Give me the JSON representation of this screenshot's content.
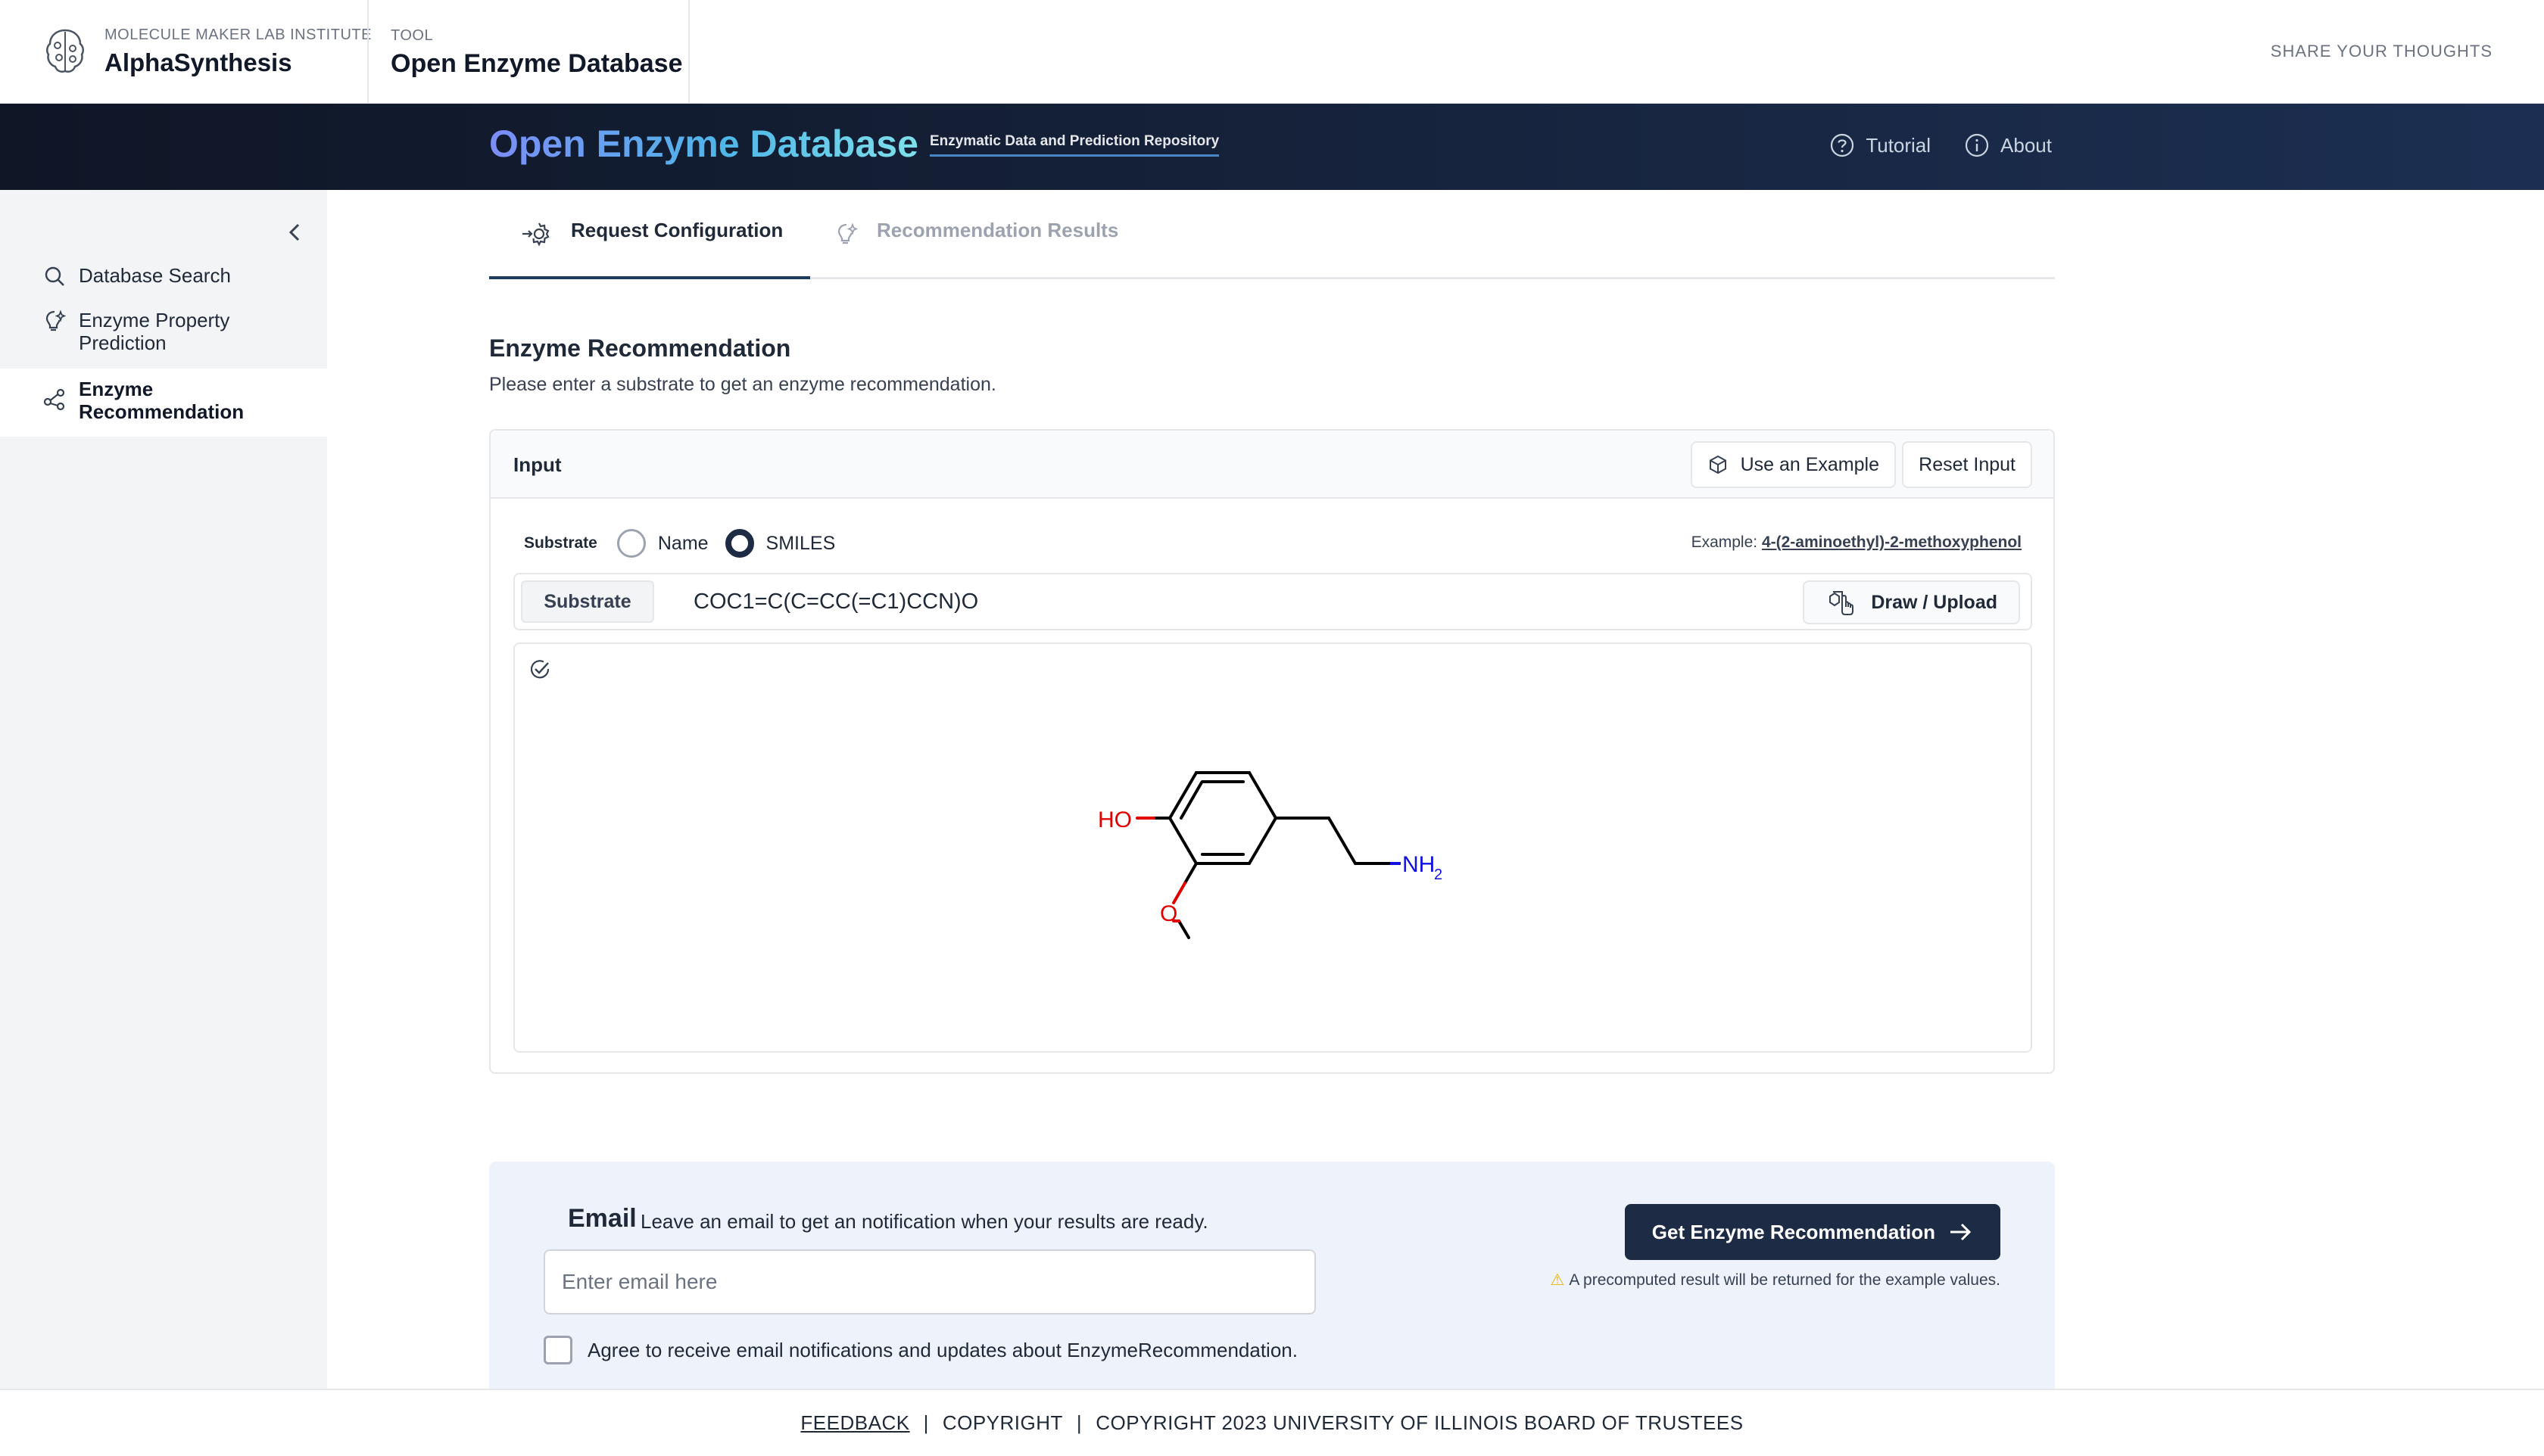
{
  "header": {
    "institute": "MOLECULE MAKER LAB INSTITUTE",
    "brand": "AlphaSynthesis",
    "tool_label": "TOOL",
    "tool_name": "Open Enzyme Database",
    "share": "SHARE YOUR THOUGHTS"
  },
  "hero": {
    "title": "Open Enzyme Database",
    "subtitle": "Enzymatic Data and Prediction Repository",
    "links": [
      {
        "label": "Tutorial",
        "icon": "question-circle-icon"
      },
      {
        "label": "About",
        "icon": "info-circle-icon"
      }
    ]
  },
  "sidebar": {
    "items": [
      {
        "label": "Database Search",
        "icon": "search-icon"
      },
      {
        "label": "Enzyme Property Prediction",
        "icon": "lightbulb-icon"
      },
      {
        "label": "Enzyme Recommendation",
        "icon": "share-nodes-icon",
        "active": true
      }
    ]
  },
  "tabs": [
    {
      "label": "Request Configuration",
      "active": true,
      "icon": "gear-arrow-icon"
    },
    {
      "label": "Recommendation Results",
      "active": false,
      "icon": "lightbulb-icon"
    }
  ],
  "section": {
    "title": "Enzyme Recommendation",
    "subtitle": "Please enter a substrate to get an enzyme recommendation."
  },
  "input_card": {
    "label": "Input",
    "use_example": "Use an Example",
    "reset": "Reset Input",
    "substrate_label": "Substrate",
    "radio_options": [
      "Name",
      "SMILES"
    ],
    "radio_selected": "SMILES",
    "example_prefix": "Example:",
    "example_link": "4-(2-aminoethyl)-2-methoxyphenol",
    "addon": "Substrate",
    "smiles_value": "COC1=C(C=CC(=C1)CCN)O",
    "draw_upload": "Draw / Upload",
    "molecule": {
      "atoms": {
        "hydroxyl": "HO",
        "oxygen": "O",
        "amine": "NH",
        "amine_subscript": "2"
      },
      "colors": {
        "oxygen": "#e00000",
        "nitrogen": "#1010e0",
        "bond": "#000000"
      }
    }
  },
  "email": {
    "label": "Email",
    "description": "Leave an email to get an notification when your results are ready.",
    "placeholder": "Enter email here",
    "agree": "Agree to receive email notifications and updates about EnzymeRecommendation.",
    "submit": "Get Enzyme Recommendation",
    "note": "A precomputed result will be returned for the example values."
  },
  "footer": {
    "feedback": "FEEDBACK",
    "copyright": "COPYRIGHT",
    "copyright_full": "COPYRIGHT 2023 UNIVERSITY OF ILLINOIS BOARD OF TRUSTEES"
  },
  "colors": {
    "navy": "#1e2b45",
    "hero_bg": "#16233c",
    "sidebar_bg": "#f3f4f6",
    "email_bg": "#eef3fb"
  }
}
